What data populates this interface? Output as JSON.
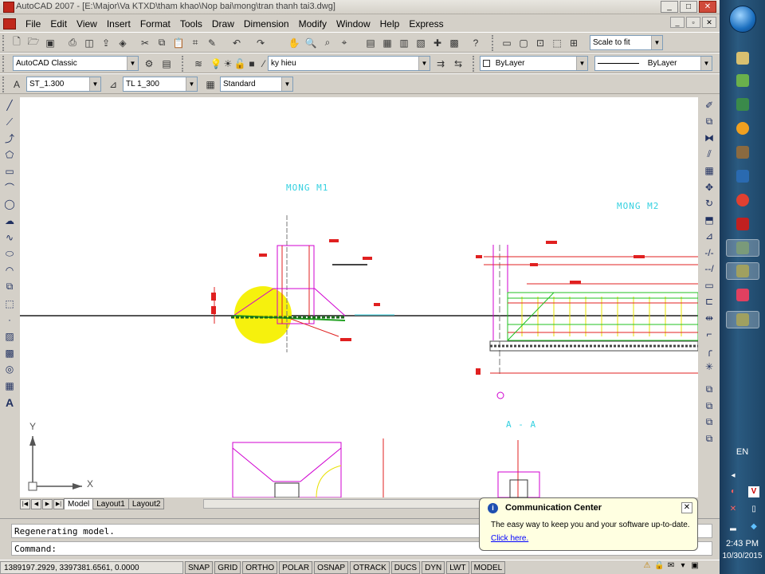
{
  "window": {
    "title": "AutoCAD 2007 - [E:\\Major\\Va KTXD\\tham khao\\Nop bai\\mong\\tran thanh tai3.dwg]",
    "controls": [
      "_",
      "□",
      "✕"
    ]
  },
  "menu": {
    "items": [
      "File",
      "Edit",
      "View",
      "Insert",
      "Format",
      "Tools",
      "Draw",
      "Dimension",
      "Modify",
      "Window",
      "Help",
      "Express"
    ],
    "mdi_controls": [
      "_",
      "▫",
      "✕"
    ]
  },
  "toolbar1": {
    "scale_combo": "Scale to fit"
  },
  "toolbar2": {
    "workspace": "AutoCAD Classic",
    "layer": "ky hieu",
    "color": "ByLayer",
    "linetype": "ByLayer"
  },
  "toolbar3": {
    "text_style": "ST_1.300",
    "dim_style": "TL 1_300",
    "table_style": "Standard"
  },
  "drawing": {
    "labels": {
      "mong_m1": "MONG M1",
      "mong_m2": "MONG M2",
      "section_aa": "A - A"
    },
    "ucs_x": "X",
    "ucs_y": "Y"
  },
  "layout_tabs": {
    "tabs": [
      "Model",
      "Layout1",
      "Layout2"
    ],
    "active": "Model"
  },
  "command": {
    "history": "Regenerating model.",
    "prompt": "Command:"
  },
  "statusbar": {
    "coordinates": "1389197.2929, 3397381.6561, 0.0000",
    "buttons": [
      "SNAP",
      "GRID",
      "ORTHO",
      "POLAR",
      "OSNAP",
      "OTRACK",
      "DUCS",
      "DYN",
      "LWT",
      "MODEL"
    ]
  },
  "balloon": {
    "title": "Communication Center",
    "message": "The easy way to keep you and your software up-to-date.",
    "link": "Click here."
  },
  "taskbar": {
    "language": "EN",
    "time": "2:43 PM",
    "date": "10/30/2015"
  }
}
